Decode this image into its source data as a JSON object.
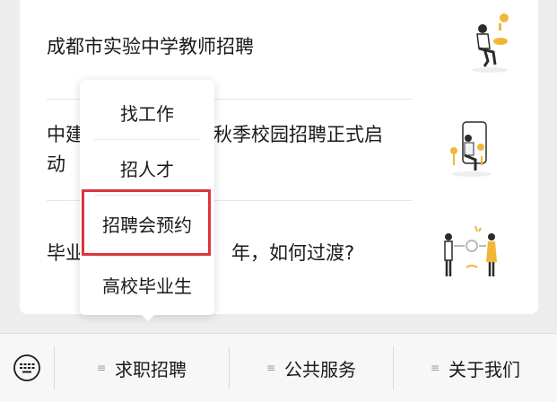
{
  "articles": [
    {
      "title": "成都市实验中学教师招聘"
    },
    {
      "title": "中建三局2021秋季校园招聘正式启动",
      "line1_visible": "中建",
      "line1_right": "秋季校园招聘正式启",
      "line2": "动"
    },
    {
      "title_visible_left": "毕业",
      "title_visible_right": "年，如何过渡?"
    }
  ],
  "popup": {
    "items": [
      "找工作",
      "招人才",
      "招聘会预约",
      "高校毕业生"
    ],
    "highlighted_index": 2,
    "highlight_color": "#d9363e"
  },
  "menubar": {
    "keyboard_icon": "keyboard-icon",
    "items": [
      {
        "label": "求职招聘",
        "icon": "menu-lines-icon"
      },
      {
        "label": "公共服务",
        "icon": "menu-lines-icon"
      },
      {
        "label": "关于我们",
        "icon": "menu-lines-icon"
      }
    ]
  }
}
